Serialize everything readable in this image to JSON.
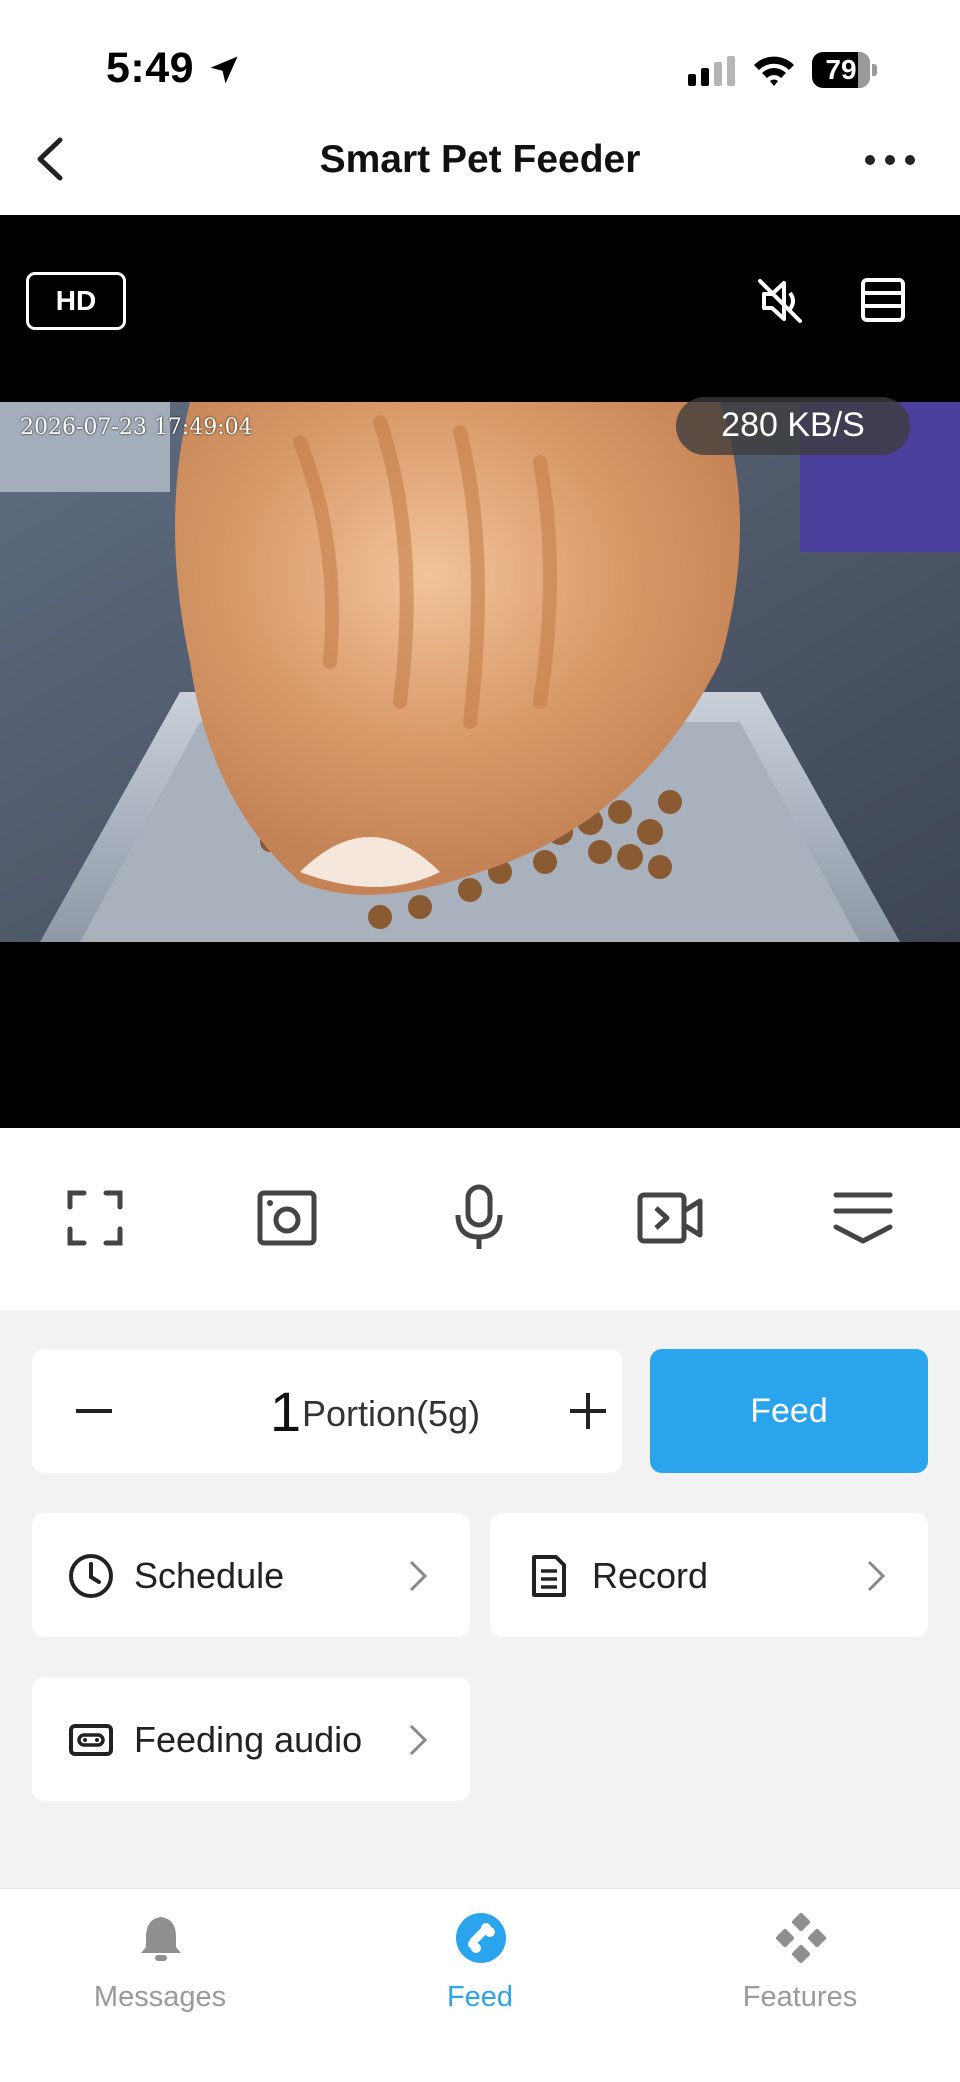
{
  "status_bar": {
    "time": "5:49",
    "battery": "79"
  },
  "header": {
    "title": "Smart Pet Feeder"
  },
  "video": {
    "quality_label": "HD",
    "timestamp": "2026-07-23 17:49:04",
    "bitrate": "280 KB/S"
  },
  "toolbar": {
    "icons": [
      "fullscreen-icon",
      "snapshot-icon",
      "microphone-icon",
      "record-video-icon",
      "collapse-icon"
    ]
  },
  "feed": {
    "portion_count": "1",
    "portion_unit": "Portion(5g)",
    "feed_label": "Feed"
  },
  "tiles": {
    "schedule": "Schedule",
    "record": "Record",
    "feeding_audio": "Feeding audio"
  },
  "tabs": {
    "messages": "Messages",
    "feed": "Feed",
    "features": "Features",
    "active": "Feed"
  },
  "colors": {
    "accent": "#2aa4ec",
    "background": "#f2f2f2"
  }
}
